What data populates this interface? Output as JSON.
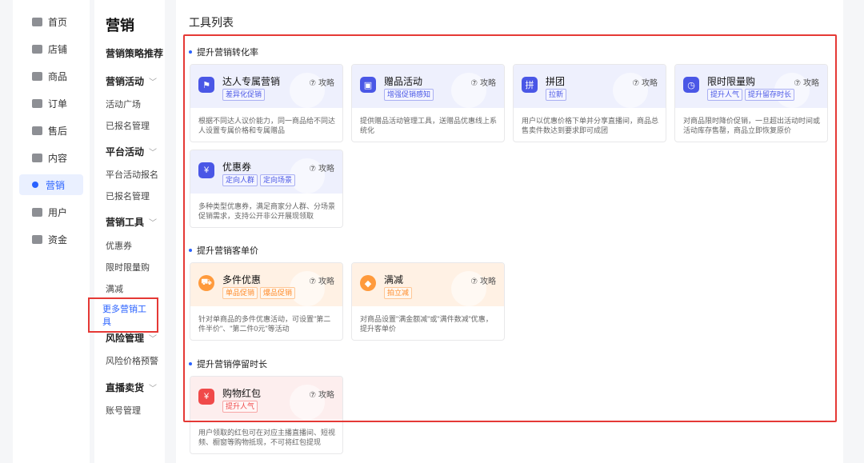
{
  "nav": {
    "items": [
      {
        "label": "首页",
        "icon": "home-icon"
      },
      {
        "label": "店铺",
        "icon": "shop-icon"
      },
      {
        "label": "商品",
        "icon": "product-icon"
      },
      {
        "label": "订单",
        "icon": "order-icon"
      },
      {
        "label": "售后",
        "icon": "after-sales-icon"
      },
      {
        "label": "内容",
        "icon": "content-icon"
      },
      {
        "label": "营销",
        "icon": "marketing-icon",
        "active": true
      },
      {
        "label": "用户",
        "icon": "user-icon"
      },
      {
        "label": "资金",
        "icon": "wallet-icon"
      }
    ]
  },
  "side": {
    "title": "营销",
    "strategy": "营销策略推荐",
    "groups": [
      {
        "label": "营销活动",
        "links": [
          "活动广场",
          "已报名管理"
        ]
      },
      {
        "label": "平台活动",
        "links": [
          "平台活动报名",
          "已报名管理"
        ]
      },
      {
        "label": "营销工具",
        "links": [
          "优惠券",
          "限时限量购",
          "满减",
          "更多营销工具"
        ]
      },
      {
        "label": "风险管理",
        "links": [
          "风险价格预警"
        ]
      },
      {
        "label": "直播卖货",
        "links": [
          "账号管理"
        ]
      }
    ]
  },
  "main": {
    "title": "工具列表",
    "guide_label": "⑦ 攻略",
    "sections": [
      {
        "title": "提升营销转化率"
      },
      {
        "title": "提升营销客单价"
      },
      {
        "title": "提升营销停留时长"
      }
    ],
    "cards": [
      {
        "name": "达人专属营销",
        "tags": [
          "差异化促销"
        ],
        "desc": "根据不同达人议价能力，同一商品给不同达人设置专属价格和专属赠品",
        "icon": "flag-icon"
      },
      {
        "name": "赠品活动",
        "tags": [
          "增强促销感知"
        ],
        "desc": "提供赠品活动管理工具，送赠品优惠线上系统化",
        "icon": "gift-icon"
      },
      {
        "name": "拼团",
        "tags": [
          "拉新"
        ],
        "desc": "用户以优惠价格下单并分享直播间，商品总售卖件数达到要求即可成团",
        "icon": "group-buy-icon"
      },
      {
        "name": "限时限量购",
        "tags": [
          "提升人气",
          "提升留存时长"
        ],
        "desc": "对商品限时降价促销，一旦超出活动时间或活动库存售罄，商品立即恢复原价",
        "icon": "timer-bag-icon"
      },
      {
        "name": "优惠券",
        "tags": [
          "定向人群",
          "定向场景"
        ],
        "desc": "多种类型优惠券，满足商家分人群、分场景促销需求，支持公开非公开展现领取",
        "icon": "coupon-icon"
      },
      {
        "name": "多件优惠",
        "tags": [
          "单品促销",
          "爆品促销"
        ],
        "desc": "针对单商品的多件优惠活动，可设置\"第二件半价\"、\"第二件0元\"等活动",
        "icon": "cart-icon"
      },
      {
        "name": "满减",
        "tags": [
          "拍立减"
        ],
        "desc": "对商品设置\"满金额减\"或\"满件数减\"优惠，提升客单价",
        "icon": "discount-tag-icon"
      },
      {
        "name": "购物红包",
        "tags": [
          "提升人气"
        ],
        "desc": "用户领取的红包可在对应主播直播间、短视频、橱窗等购物抵现，不可将红包提现",
        "icon": "red-packet-icon"
      }
    ]
  }
}
